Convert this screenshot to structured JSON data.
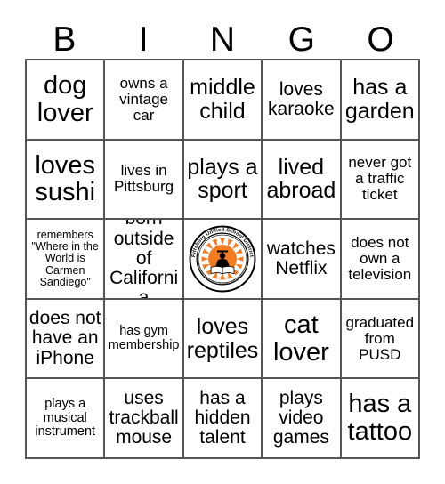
{
  "header": {
    "letters": [
      "B",
      "I",
      "N",
      "G",
      "O"
    ]
  },
  "logo": {
    "name": "pusd-seal-logo",
    "top_arc_text": "Pittsburg Unified School District",
    "bottom_arc_text": "Nurturing Tomorrow's Scholars and Leaders Today",
    "established_text": "EST. 1920",
    "ring_color": "#000000",
    "sun_color": "#F47B20",
    "figure_color": "#000000",
    "book_color": "#FFFFFF"
  },
  "grid": {
    "rows": [
      [
        {
          "text": "dog lover",
          "size": "fs-xxl"
        },
        {
          "text": "owns a vintage car",
          "size": "fs-m"
        },
        {
          "text": "middle child",
          "size": "fs-xl"
        },
        {
          "text": "loves karaoke",
          "size": "fs-l"
        },
        {
          "text": "has a garden",
          "size": "fs-xl"
        }
      ],
      [
        {
          "text": "loves sushi",
          "size": "fs-xxl"
        },
        {
          "text": "lives in Pittsburg",
          "size": "fs-m"
        },
        {
          "text": "plays a sport",
          "size": "fs-xl"
        },
        {
          "text": "lived abroad",
          "size": "fs-xl"
        },
        {
          "text": "never got a traffic ticket",
          "size": "fs-m"
        }
      ],
      [
        {
          "text": "remembers \"Where in the World is Carmen Sandiego\"",
          "size": "fs-xs"
        },
        {
          "text": "born outside of California",
          "size": "fs-l"
        },
        {
          "text": "",
          "size": "free",
          "is_free_space": true
        },
        {
          "text": "watches Netflix",
          "size": "fs-l"
        },
        {
          "text": "does not own a television",
          "size": "fs-m"
        }
      ],
      [
        {
          "text": "does not have an iPhone",
          "size": "fs-l"
        },
        {
          "text": "has gym membership",
          "size": "fs-s"
        },
        {
          "text": "loves reptiles",
          "size": "fs-xl"
        },
        {
          "text": "cat lover",
          "size": "fs-xxl"
        },
        {
          "text": "graduated from PUSD",
          "size": "fs-m"
        }
      ],
      [
        {
          "text": "plays a musical instrument",
          "size": "fs-s"
        },
        {
          "text": "uses trackball mouse",
          "size": "fs-l"
        },
        {
          "text": "has a hidden talent",
          "size": "fs-l"
        },
        {
          "text": "plays video games",
          "size": "fs-l"
        },
        {
          "text": "has a tattoo",
          "size": "fs-xxl"
        }
      ]
    ]
  }
}
